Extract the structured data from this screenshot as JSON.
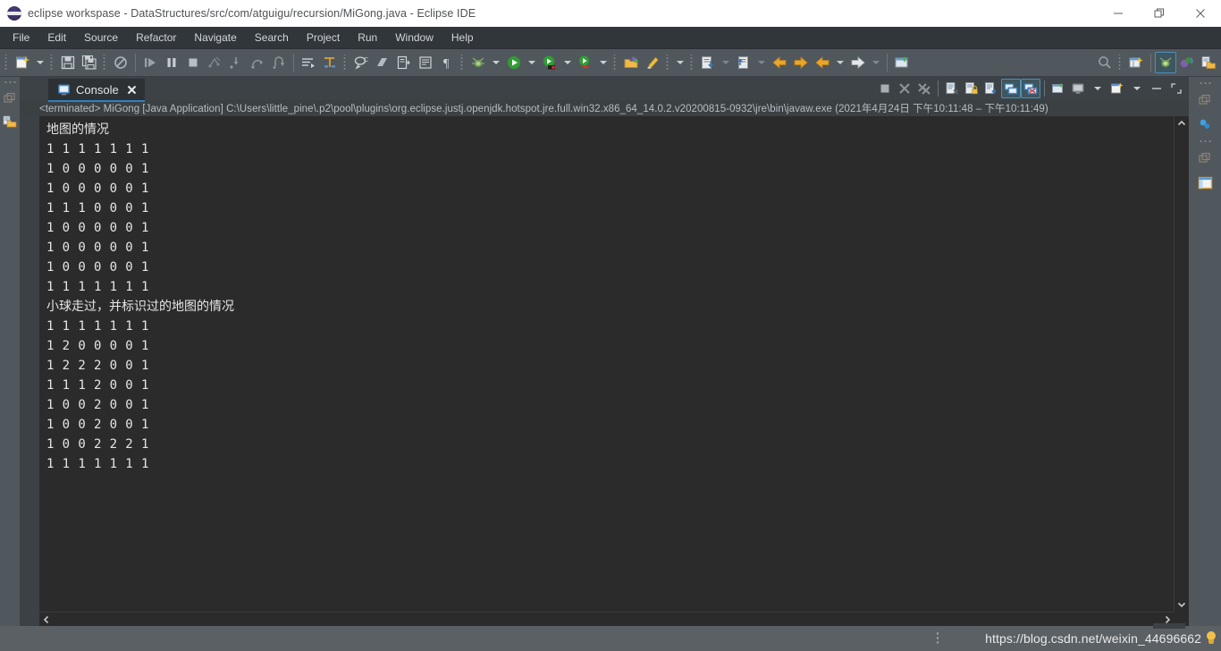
{
  "window": {
    "title": "eclipse workspase - DataStructures/src/com/atguigu/recursion/MiGong.java - Eclipse IDE",
    "logo_icon": "eclipse-logo-icon",
    "controls": [
      {
        "name": "minimize-button",
        "icon": "minimize-icon"
      },
      {
        "name": "restore-button",
        "icon": "restore-icon"
      },
      {
        "name": "close-button",
        "icon": "close-icon"
      }
    ]
  },
  "menubar": {
    "items": [
      {
        "label": "File"
      },
      {
        "label": "Edit"
      },
      {
        "label": "Source"
      },
      {
        "label": "Refactor"
      },
      {
        "label": "Navigate"
      },
      {
        "label": "Search"
      },
      {
        "label": "Project"
      },
      {
        "label": "Run"
      },
      {
        "label": "Window"
      },
      {
        "label": "Help"
      }
    ]
  },
  "toolbar": {
    "items": [
      {
        "name": "new-wizard-button",
        "icon": "new-file-icon"
      },
      {
        "name": "new-wizard-dropdown",
        "icon": "chevron-down-icon"
      },
      {
        "name": "save-button",
        "icon": "save-floppy-icon"
      },
      {
        "name": "save-all-button",
        "icon": "save-all-icon"
      },
      {
        "name": "skip-all-breakpoints-button",
        "icon": "breakpoint-skip-icon"
      },
      {
        "name": "resume-button",
        "icon": "resume-icon"
      },
      {
        "name": "suspend-button",
        "icon": "pause-icon"
      },
      {
        "name": "terminate-button",
        "icon": "stop-square-icon"
      },
      {
        "name": "disconnect-button",
        "icon": "disconnect-icon"
      },
      {
        "name": "step-into-button",
        "icon": "step-into-icon"
      },
      {
        "name": "step-over-button",
        "icon": "step-over-icon"
      },
      {
        "name": "step-return-button",
        "icon": "step-return-icon"
      },
      {
        "name": "toggle-word-wrap-button",
        "icon": "word-wrap-icon"
      },
      {
        "name": "toggle-mark-occurrences-button",
        "icon": "mark-occurrences-icon"
      },
      {
        "name": "new-java-class-button",
        "icon": "java-class-icon"
      },
      {
        "name": "new-java-package-button",
        "icon": "java-package-icon"
      },
      {
        "name": "open-type-button",
        "icon": "open-type-icon"
      },
      {
        "name": "show-whitespace-button",
        "icon": "pilcrow-icon"
      },
      {
        "name": "debug-button",
        "icon": "debug-bug-icon"
      },
      {
        "name": "debug-dropdown",
        "icon": "chevron-down-icon"
      },
      {
        "name": "run-button",
        "icon": "run-green-play-icon"
      },
      {
        "name": "run-dropdown",
        "icon": "chevron-down-icon"
      },
      {
        "name": "run-coverage-button",
        "icon": "coverage-icon"
      },
      {
        "name": "run-coverage-dropdown",
        "icon": "chevron-down-icon"
      },
      {
        "name": "external-tools-button",
        "icon": "external-tools-icon"
      },
      {
        "name": "external-tools-dropdown",
        "icon": "chevron-down-icon"
      },
      {
        "name": "open-task-button",
        "icon": "task-folder-icon"
      },
      {
        "name": "quick-fix-button",
        "icon": "paintbrush-icon"
      },
      {
        "name": "next-annotation-button",
        "icon": "next-annotation-icon"
      },
      {
        "name": "next-annotation-dropdown",
        "icon": "chevron-down-icon"
      },
      {
        "name": "previous-annotation-button",
        "icon": "previous-annotation-icon"
      },
      {
        "name": "previous-annotation-dropdown",
        "icon": "chevron-down-icon"
      },
      {
        "name": "back-button",
        "icon": "arrow-left-yellow-icon"
      },
      {
        "name": "forward-button",
        "icon": "arrow-right-yellow-icon"
      },
      {
        "name": "back-history-button",
        "icon": "arrow-left-icon"
      },
      {
        "name": "back-history-dropdown",
        "icon": "chevron-down-icon"
      },
      {
        "name": "forward-history-button",
        "icon": "arrow-right-white-icon"
      },
      {
        "name": "forward-history-dropdown",
        "icon": "chevron-down-icon"
      },
      {
        "name": "new-window-button",
        "icon": "new-window-icon"
      }
    ],
    "right_items": [
      {
        "name": "search-button",
        "icon": "search-icon"
      },
      {
        "name": "open-perspective-button",
        "icon": "open-perspective-icon"
      },
      {
        "name": "perspective-debug-button",
        "icon": "debug-perspective-icon"
      },
      {
        "name": "perspective-java-button",
        "icon": "java-perspective-icon"
      },
      {
        "name": "perspective-resource-button",
        "icon": "resource-perspective-icon"
      }
    ]
  },
  "left_bar": {
    "items": [
      {
        "name": "restore-view-button",
        "icon": "restore-view-icon"
      },
      {
        "name": "package-explorer-button",
        "icon": "package-explorer-icon"
      }
    ]
  },
  "right_bar": {
    "items": [
      {
        "name": "restore-view-top-button",
        "icon": "restore-view-icon"
      },
      {
        "name": "outline-view-button",
        "icon": "outline-spheres-icon"
      },
      {
        "name": "restore-view-bottom-button",
        "icon": "restore-view-icon"
      },
      {
        "name": "task-list-button",
        "icon": "task-list-icon"
      }
    ]
  },
  "console_panel": {
    "tab": {
      "label": "Console",
      "icon": "console-icon",
      "close_icon": "close-icon"
    },
    "toolbar": [
      {
        "name": "terminate-console-button",
        "icon": "stop-square-icon"
      },
      {
        "name": "remove-launch-button",
        "icon": "remove-x-icon"
      },
      {
        "name": "remove-all-terminated-button",
        "icon": "remove-all-x-icon"
      },
      {
        "name": "clear-console-button",
        "icon": "clear-console-icon"
      },
      {
        "name": "scroll-lock-button",
        "icon": "scroll-lock-icon"
      },
      {
        "name": "word-wrap-console-button",
        "icon": "word-wrap-icon"
      },
      {
        "name": "show-console-on-output-button",
        "icon": "show-console-output-icon"
      },
      {
        "name": "show-console-on-error-button",
        "icon": "show-console-error-icon"
      },
      {
        "name": "pin-console-button",
        "icon": "pin-console-icon"
      },
      {
        "name": "display-selected-console-button",
        "icon": "display-console-icon"
      },
      {
        "name": "display-selected-console-dropdown",
        "icon": "chevron-down-icon"
      },
      {
        "name": "open-console-button",
        "icon": "open-console-icon"
      },
      {
        "name": "open-console-dropdown",
        "icon": "chevron-down-icon"
      },
      {
        "name": "minimize-panel-button",
        "icon": "minimize-icon"
      },
      {
        "name": "maximize-panel-button",
        "icon": "maximize-icon"
      }
    ],
    "status_line": "<terminated> MiGong [Java Application] C:\\Users\\little_pine\\.p2\\pool\\plugins\\org.eclipse.justj.openjdk.hotspot.jre.full.win32.x86_64_14.0.2.v20200815-0932\\jre\\bin\\javaw.exe  (2021年4月24日 下午10:11:48 – 下午10:11:49)",
    "output_lines": [
      {
        "text": "地图的情况",
        "cjk": true
      },
      {
        "text": "1 1 1 1 1 1 1",
        "cjk": false
      },
      {
        "text": "1 0 0 0 0 0 1",
        "cjk": false
      },
      {
        "text": "1 0 0 0 0 0 1",
        "cjk": false
      },
      {
        "text": "1 1 1 0 0 0 1",
        "cjk": false
      },
      {
        "text": "1 0 0 0 0 0 1",
        "cjk": false
      },
      {
        "text": "1 0 0 0 0 0 1",
        "cjk": false
      },
      {
        "text": "1 0 0 0 0 0 1",
        "cjk": false
      },
      {
        "text": "1 1 1 1 1 1 1",
        "cjk": false
      },
      {
        "text": "小球走过，并标识过的地图的情况",
        "cjk": true
      },
      {
        "text": "1 1 1 1 1 1 1",
        "cjk": false
      },
      {
        "text": "1 2 0 0 0 0 1",
        "cjk": false
      },
      {
        "text": "1 2 2 2 0 0 1",
        "cjk": false
      },
      {
        "text": "1 1 1 2 0 0 1",
        "cjk": false
      },
      {
        "text": "1 0 0 2 0 0 1",
        "cjk": false
      },
      {
        "text": "1 0 0 2 0 0 1",
        "cjk": false
      },
      {
        "text": "1 0 0 2 2 2 1",
        "cjk": false
      },
      {
        "text": "1 1 1 1 1 1 1",
        "cjk": false
      }
    ],
    "scrollbars": {
      "up_icon": "chevron-up-icon",
      "down_icon": "chevron-down-icon",
      "left_icon": "chevron-left-icon",
      "right_icon": "chevron-right-icon"
    }
  },
  "statusbar": {
    "watermark": "https://blog.csdn.net/weixin_44696662",
    "bulb_icon": "lightbulb-icon"
  },
  "colors": {
    "titlebar_bg": "#ffffff",
    "menubar_bg": "#31363b",
    "toolbar_bg": "#51585d",
    "console_bg": "#2b2b2b",
    "console_text": "#e6e6e6",
    "tab_accent": "#2f7fc2",
    "statusbar_bg": "#5a6064"
  }
}
